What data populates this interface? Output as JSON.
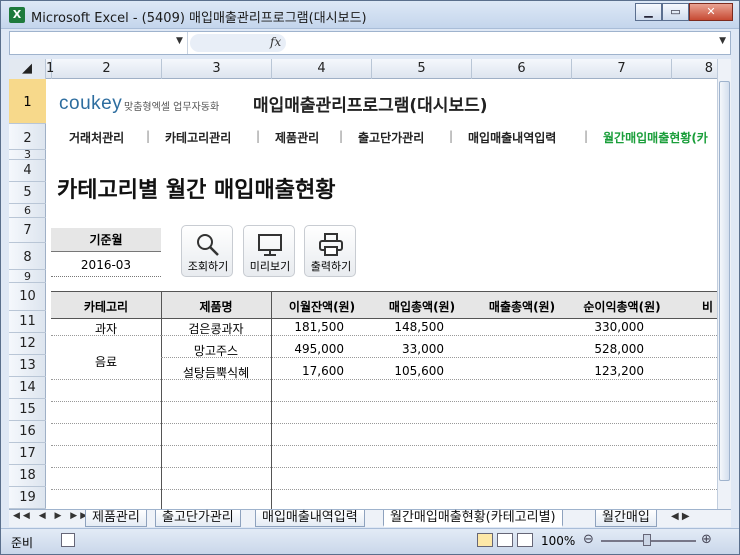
{
  "window": {
    "title": "Microsoft Excel - (5409) 매입매출관리프로그램(대시보드)",
    "app_icon": "X"
  },
  "formula_bar": {
    "fx": "fx",
    "cell_ref": "",
    "content": ""
  },
  "columns": [
    "1",
    "2",
    "3",
    "4",
    "5",
    "6",
    "7",
    "8"
  ],
  "rows": [
    "1",
    "2",
    "3",
    "4",
    "5",
    "6",
    "7",
    "8",
    "9",
    "10",
    "11",
    "12",
    "13",
    "14",
    "15",
    "16",
    "17",
    "18",
    "19"
  ],
  "header": {
    "brand": "coukey",
    "brand_tag": "맞춤형엑셀 업무자동화",
    "program_title": "매입매출관리프로그램(대시보드)"
  },
  "nav": {
    "items": [
      "거래처관리",
      "카테고리관리",
      "제품관리",
      "출고단가관리",
      "매입매출내역입력",
      "월간매입매출현황(카"
    ],
    "separator": "|",
    "active_color": "#1a9e3a"
  },
  "report": {
    "title": "카테고리별 월간 매입매출현황"
  },
  "filter": {
    "label": "기준월",
    "value": "2016-03"
  },
  "buttons": {
    "search": "조회하기",
    "preview": "미리보기",
    "print": "출력하기"
  },
  "table": {
    "headers": [
      "카테고리",
      "제품명",
      "이월잔액(원)",
      "매입총액(원)",
      "매출총액(원)",
      "순이익총액(원)",
      "비"
    ],
    "rows": [
      {
        "category": "과자",
        "product": "검은콩과자",
        "carry": "181,500",
        "purchase": "148,500",
        "sales": "",
        "profit": "330,000"
      },
      {
        "category": "음료",
        "product": "망고주스",
        "carry": "495,000",
        "purchase": "33,000",
        "sales": "",
        "profit": "528,000"
      },
      {
        "category": "",
        "product": "설탕듬뿍식혜",
        "carry": "17,600",
        "purchase": "105,600",
        "sales": "",
        "profit": "123,200"
      }
    ]
  },
  "sheet_tabs": [
    "제품관리",
    "출고단가관리",
    "매입매출내역입력",
    "월간매입매출현황(카테고리별)",
    "월간매입"
  ],
  "status": {
    "ready": "준비",
    "zoom": "100%"
  }
}
